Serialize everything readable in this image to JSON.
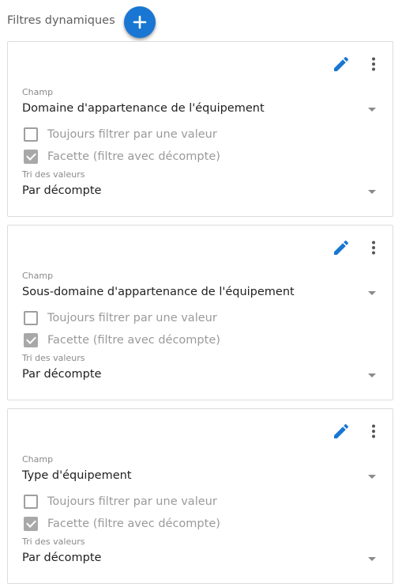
{
  "header": {
    "title": "Filtres dynamiques",
    "add_icon": "plus-icon",
    "accent_color": "#1976d2"
  },
  "filters": [
    {
      "edit_icon": "pencil-icon",
      "more_icon": "more-vert-icon",
      "champ_label": "Champ",
      "champ_value": "Domaine d'appartenance de l'équipement",
      "always_filter_label": "Toujours filtrer par une valeur",
      "always_filter_checked": false,
      "facet_label": "Facette (filtre avec décompte)",
      "facet_checked": true,
      "sort_label": "Tri des valeurs",
      "sort_value": "Par décompte"
    },
    {
      "edit_icon": "pencil-icon",
      "more_icon": "more-vert-icon",
      "champ_label": "Champ",
      "champ_value": "Sous-domaine d'appartenance de l'équipement",
      "always_filter_label": "Toujours filtrer par une valeur",
      "always_filter_checked": false,
      "facet_label": "Facette (filtre avec décompte)",
      "facet_checked": true,
      "sort_label": "Tri des valeurs",
      "sort_value": "Par décompte"
    },
    {
      "edit_icon": "pencil-icon",
      "more_icon": "more-vert-icon",
      "champ_label": "Champ",
      "champ_value": "Type d'équipement",
      "always_filter_label": "Toujours filtrer par une valeur",
      "always_filter_checked": false,
      "facet_label": "Facette (filtre avec décompte)",
      "facet_checked": true,
      "sort_label": "Tri des valeurs",
      "sort_value": "Par décompte"
    }
  ]
}
